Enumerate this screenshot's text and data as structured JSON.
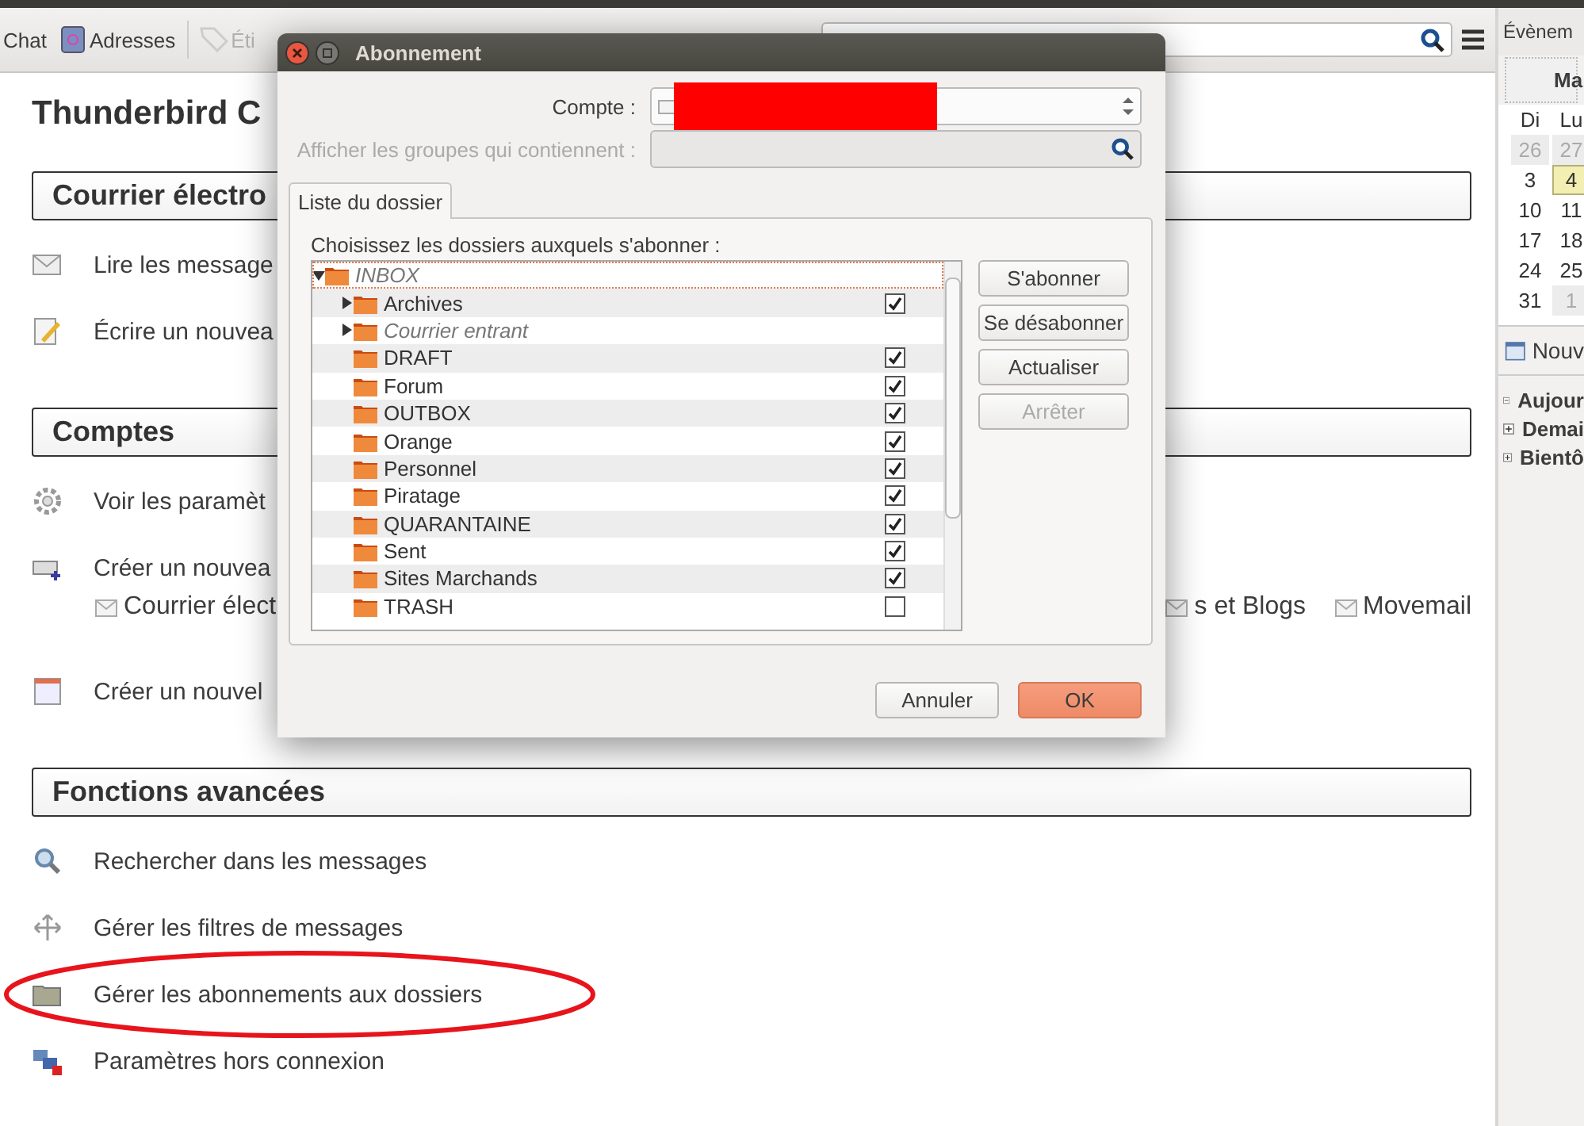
{
  "toolbar": {
    "items": [
      {
        "label": "Chat",
        "kind": "plain",
        "disabled": false
      },
      {
        "label": "Adresses",
        "kind": "address_book",
        "disabled": false
      },
      {
        "label": "Éti",
        "kind": "tag",
        "disabled": true
      }
    ]
  },
  "main": {
    "title": "Thunderbird C",
    "sections": [
      {
        "heading": "Courrier électro",
        "items": [
          {
            "label": "Lire les message",
            "kind": "read"
          },
          {
            "label": "Écrire un nouvea",
            "kind": "write"
          }
        ]
      },
      {
        "heading": "Comptes",
        "items": [
          {
            "label": "Voir les paramèt",
            "kind": "settings"
          },
          {
            "label": "Créer un nouvea",
            "kind": "new_account",
            "options": [
              "Courrier élect",
              "s et Blogs",
              "Movemail"
            ]
          },
          {
            "label": "Créer un nouvel",
            "kind": "calendar"
          }
        ]
      },
      {
        "heading": "Fonctions avancées",
        "items": [
          {
            "label": "Rechercher dans les messages",
            "kind": "search"
          },
          {
            "label": "Gérer les filtres de messages",
            "kind": "filters"
          },
          {
            "label": "Gérer les abonnements aux dossiers",
            "kind": "subscriptions",
            "circled": true
          },
          {
            "label": "Paramètres hors connexion",
            "kind": "offline"
          }
        ]
      }
    ]
  },
  "sidebar": {
    "title": "Évènem",
    "calendar": {
      "month": "Ma",
      "weekdays": [
        "Di",
        "Lu"
      ],
      "weeks": [
        [
          {
            "day": "26",
            "other_month": true,
            "selected": false
          },
          {
            "day": "27",
            "other_month": true,
            "selected": false
          }
        ],
        [
          {
            "day": "3",
            "other_month": false,
            "selected": false
          },
          {
            "day": "4",
            "other_month": false,
            "selected": true
          }
        ],
        [
          {
            "day": "10",
            "other_month": false,
            "selected": false
          },
          {
            "day": "11",
            "other_month": false,
            "selected": false
          }
        ],
        [
          {
            "day": "17",
            "other_month": false,
            "selected": false
          },
          {
            "day": "18",
            "other_month": false,
            "selected": false
          }
        ],
        [
          {
            "day": "24",
            "other_month": false,
            "selected": false
          },
          {
            "day": "25",
            "other_month": false,
            "selected": false
          }
        ],
        [
          {
            "day": "31",
            "other_month": false,
            "selected": false
          },
          {
            "day": "1",
            "other_month": true,
            "selected": false
          }
        ]
      ]
    },
    "new_button": "Nouv",
    "groups": [
      {
        "label": "Aujour",
        "expanded": true
      },
      {
        "label": "Demai",
        "expanded": false
      },
      {
        "label": "Bientô",
        "expanded": false
      }
    ]
  },
  "dialog": {
    "title": "Abonnement",
    "account": {
      "label": "Compte :",
      "redacted": true
    },
    "filter": {
      "label": "Afficher les groupes qui contiennent :",
      "disabled": true
    },
    "tabs": [
      {
        "label": "Liste du dossier",
        "selected": true
      }
    ],
    "list_label": "Choisissez les dossiers auxquels s'abonner :",
    "folders": [
      {
        "name": "INBOX",
        "subscribable": false,
        "focused": true,
        "expanded": true,
        "children": [
          {
            "name": "Archives",
            "subscribable": true,
            "checked": true,
            "expanded": false
          },
          {
            "name": "Courrier entrant",
            "subscribable": false,
            "expanded": false
          },
          {
            "name": "DRAFT",
            "subscribable": true,
            "checked": true
          },
          {
            "name": "Forum",
            "subscribable": true,
            "checked": true
          },
          {
            "name": "OUTBOX",
            "subscribable": true,
            "checked": true
          },
          {
            "name": "Orange",
            "subscribable": true,
            "checked": true
          },
          {
            "name": "Personnel",
            "subscribable": true,
            "checked": true
          },
          {
            "name": "Piratage",
            "subscribable": true,
            "checked": true
          },
          {
            "name": "QUARANTAINE",
            "subscribable": true,
            "checked": true
          },
          {
            "name": "Sent",
            "subscribable": true,
            "checked": true
          },
          {
            "name": "Sites Marchands",
            "subscribable": true,
            "checked": true
          },
          {
            "name": "TRASH",
            "subscribable": true,
            "checked": false
          }
        ]
      }
    ],
    "side_buttons": [
      {
        "label": "S'abonner",
        "disabled": false
      },
      {
        "label": "Se désabonner",
        "disabled": false
      },
      {
        "label": "Actualiser",
        "disabled": false
      },
      {
        "label": "Arrêter",
        "disabled": true
      }
    ],
    "buttons": [
      {
        "label": "Annuler",
        "default": false
      },
      {
        "label": "OK",
        "default": true
      }
    ]
  }
}
